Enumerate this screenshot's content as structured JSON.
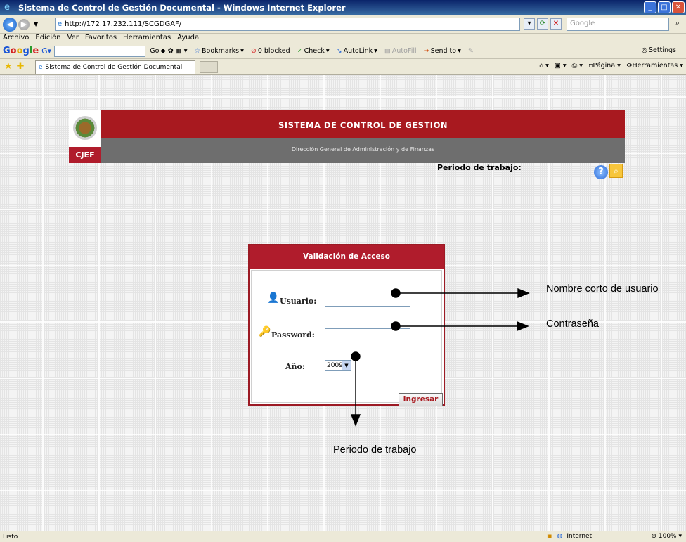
{
  "window": {
    "title": "Sistema de Control de Gestión Documental - Windows Internet Explorer",
    "address": "http://172.17.232.111/SCGDGAF/",
    "search_placeholder": "Google"
  },
  "menu": [
    "Archivo",
    "Edición",
    "Ver",
    "Favoritos",
    "Herramientas",
    "Ayuda"
  ],
  "google_toolbar": {
    "logo": "Google",
    "go": "Go",
    "bookmarks": "Bookmarks",
    "blocked": "0 blocked",
    "check": "Check",
    "autolink": "AutoLink",
    "autofill": "AutoFill",
    "sendto": "Send to",
    "settings": "Settings"
  },
  "tab": {
    "label": "Sistema de Control de Gestión Documental",
    "pagina": "Página",
    "herramientas": "Herramientas"
  },
  "page": {
    "header_title": "SISTEMA DE CONTROL DE GESTION",
    "header_subtitle": "Dirección General de Administración y de Finanzas",
    "logo_text": "CJEF",
    "periodo_label": "Periodo de trabajo:"
  },
  "login": {
    "title": "Validación de Acceso",
    "usuario_label": "Usuario:",
    "password_label": "Password:",
    "anio_label": "Año:",
    "anio_value": "2009",
    "submit": "Ingresar"
  },
  "annotations": {
    "usuario": "Nombre corto de usuario",
    "password": "Contraseña",
    "periodo": "Periodo de trabajo"
  },
  "status": {
    "left": "Listo",
    "zone": "Internet",
    "zoom": "100%"
  }
}
